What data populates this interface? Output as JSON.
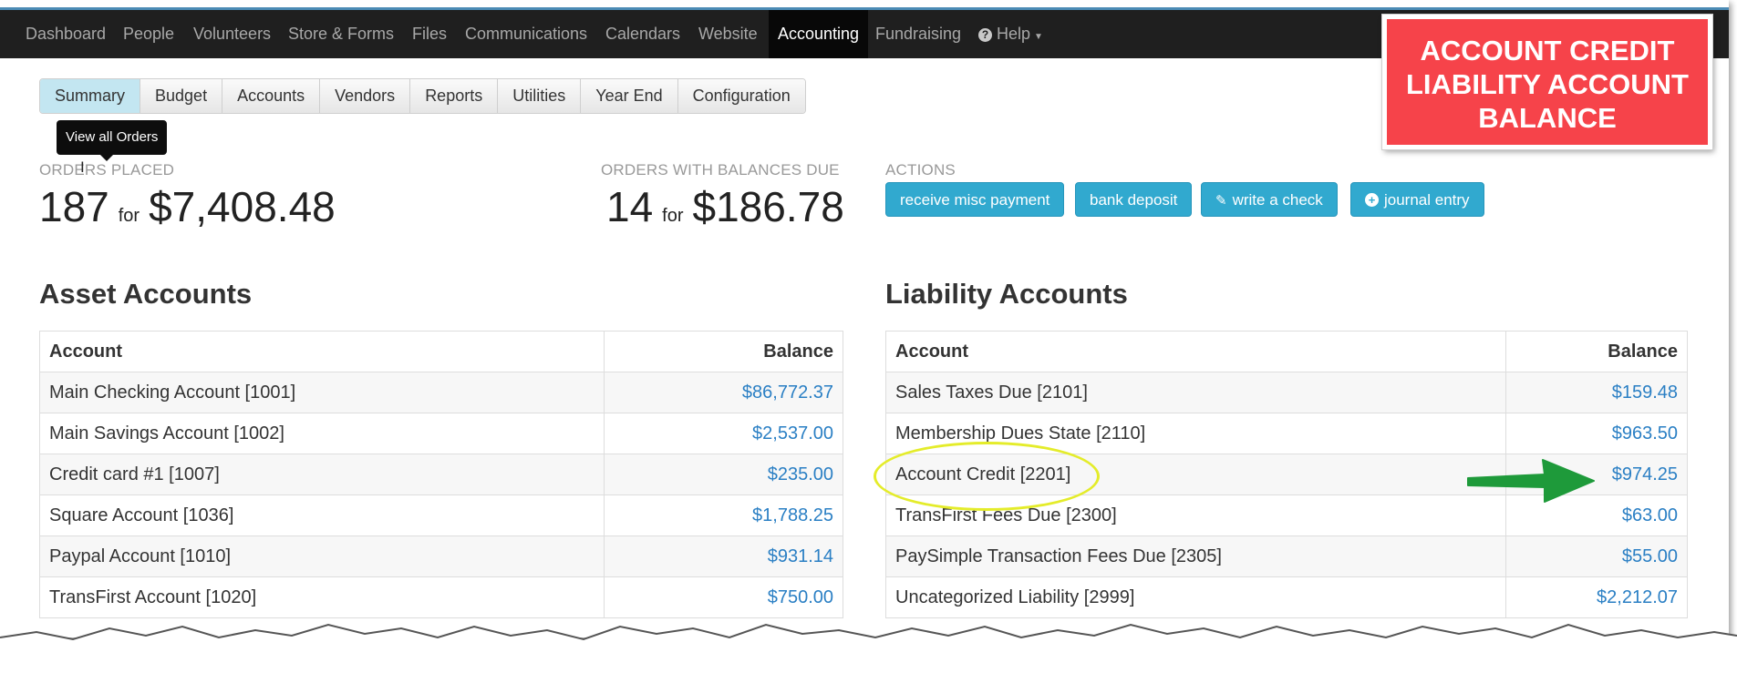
{
  "nav": {
    "items": [
      {
        "label": "Dashboard"
      },
      {
        "label": "People"
      },
      {
        "label": "Volunteers"
      },
      {
        "label": "Store & Forms"
      },
      {
        "label": "Files"
      },
      {
        "label": "Communications"
      },
      {
        "label": "Calendars"
      },
      {
        "label": "Website"
      },
      {
        "label": "Accounting"
      },
      {
        "label": "Fundraising"
      }
    ],
    "help_label": "Help",
    "active": "Accounting"
  },
  "subtabs": [
    "Summary",
    "Budget",
    "Accounts",
    "Vendors",
    "Reports",
    "Utilities",
    "Year End",
    "Configuration"
  ],
  "tooltip": "View all Orders",
  "orders_placed": {
    "label": "ORDERS PLACED",
    "count": "187",
    "for": "for",
    "amount": "$7,408.48"
  },
  "orders_due": {
    "label": "ORDERS WITH BALANCES DUE",
    "count": "14",
    "for": "for",
    "amount": "$186.78"
  },
  "actions": {
    "label": "ACTIONS",
    "buttons": [
      {
        "label": "receive misc payment"
      },
      {
        "label": "bank deposit"
      },
      {
        "label": "write a check",
        "icon": "pencil-icon"
      },
      {
        "label": "journal entry",
        "icon": "plus-circle-icon"
      }
    ]
  },
  "asset": {
    "title": "Asset Accounts",
    "columns": [
      "Account",
      "Balance"
    ],
    "rows": [
      {
        "account": "Main Checking Account [1001]",
        "balance": "$86,772.37"
      },
      {
        "account": "Main Savings Account [1002]",
        "balance": "$2,537.00"
      },
      {
        "account": "Credit card #1 [1007]",
        "balance": "$235.00"
      },
      {
        "account": "Square Account [1036]",
        "balance": "$1,788.25"
      },
      {
        "account": "Paypal Account [1010]",
        "balance": "$931.14"
      },
      {
        "account": "TransFirst Account [1020]",
        "balance": "$750.00"
      }
    ]
  },
  "liability": {
    "title": "Liability Accounts",
    "columns": [
      "Account",
      "Balance"
    ],
    "rows": [
      {
        "account": "Sales Taxes Due [2101]",
        "balance": "$159.48"
      },
      {
        "account": "Membership Dues State [2110]",
        "balance": "$963.50"
      },
      {
        "account": "Account Credit [2201]",
        "balance": "$974.25"
      },
      {
        "account": "TransFirst Fees Due [2300]",
        "balance": "$63.00"
      },
      {
        "account": "PaySimple Transaction Fees Due [2305]",
        "balance": "$55.00"
      },
      {
        "account": "Uncategorized Liability [2999]",
        "balance": "$2,212.07"
      }
    ]
  },
  "callout": {
    "lines": [
      "ACCOUNT CREDIT",
      "LIABILITY ACCOUNT",
      "BALANCE"
    ]
  },
  "colors": {
    "navbar": "#1f1f1f",
    "link": "#2a7fc4",
    "button": "#31a9cf",
    "callout": "#f6434a",
    "highlight": "#e4ec2a",
    "arrow": "#1e9a3a"
  }
}
